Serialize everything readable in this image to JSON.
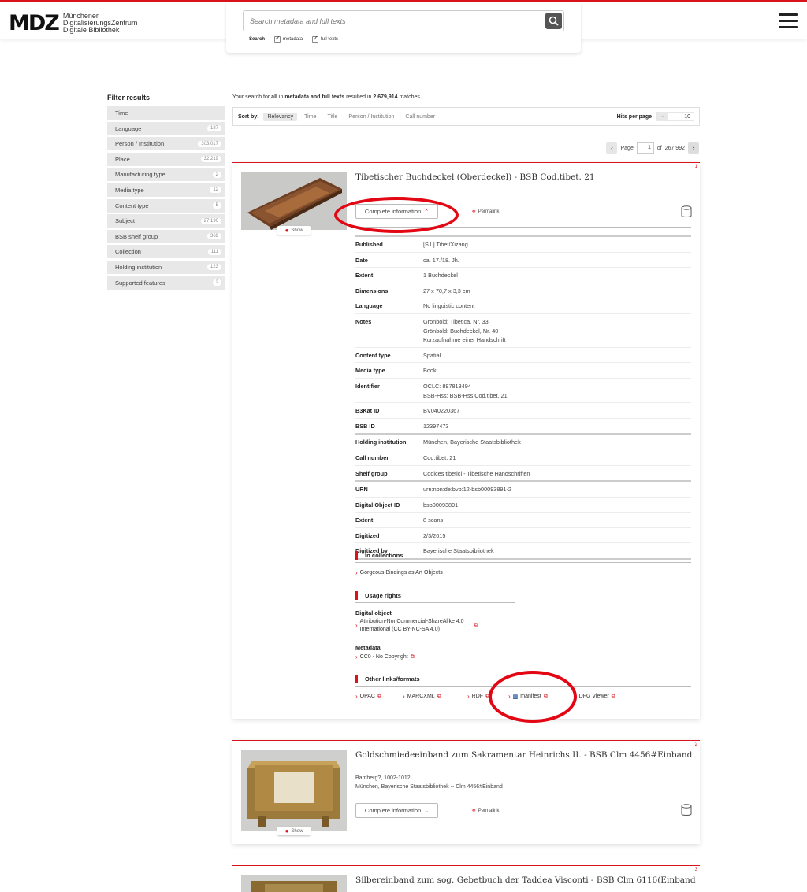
{
  "header": {
    "logo_mark": "MDZ",
    "logo_lines": [
      "Münchener",
      "DigitalisierungsZentrum",
      "Digitale Bibliothek"
    ],
    "search_placeholder": "Search metadata and full texts",
    "search_label": "Search",
    "opt_metadata": "metadata",
    "opt_fulltexts": "full texts"
  },
  "sidebar": {
    "title": "Filter results",
    "facets": [
      {
        "label": "Time",
        "count": ""
      },
      {
        "label": "Language",
        "count": "187"
      },
      {
        "label": "Person / Institution",
        "count": "303,017"
      },
      {
        "label": "Place",
        "count": "32,219"
      },
      {
        "label": "Manufacturing type",
        "count": "2"
      },
      {
        "label": "Media type",
        "count": "12"
      },
      {
        "label": "Content type",
        "count": "5"
      },
      {
        "label": "Subject",
        "count": "27,190"
      },
      {
        "label": "BSB shelf group",
        "count": "369"
      },
      {
        "label": "Collection",
        "count": "111"
      },
      {
        "label": "Holding institution",
        "count": "123"
      },
      {
        "label": "Supported features",
        "count": "2"
      }
    ]
  },
  "summary": {
    "prefix": "Your search for ",
    "all": "all",
    "mid1": " in ",
    "scope": "metadata and full texts",
    "mid2": " resulted in ",
    "count": "2,679,914",
    "suffix": " matches."
  },
  "sort": {
    "label": "Sort by:",
    "options": [
      "Relevancy",
      "Time",
      "Title",
      "Person / Institution",
      "Call number"
    ],
    "hits_label": "Hits per page",
    "hits_value": "10"
  },
  "pager": {
    "page_label": "Page",
    "page": "1",
    "of_label": "of",
    "total": "267,992"
  },
  "results": [
    {
      "num": "1",
      "title": "Tibetischer Buchdeckel (Oberdeckel) - BSB Cod.tibet. 21",
      "show": "Show",
      "complete": "Complete information",
      "permalink": "Permalink",
      "meta": [
        {
          "k": "Published",
          "v": [
            "[S.l.] Tibet/Xizang"
          ]
        },
        {
          "k": "Date",
          "v": [
            "ca. 17./18. Jh."
          ]
        },
        {
          "k": "Extent",
          "v": [
            "1 Buchdeckel"
          ]
        },
        {
          "k": "Dimensions",
          "v": [
            "27 x 70,7 x 3,3 cm"
          ]
        },
        {
          "k": "Language",
          "v": [
            "No linguistic content"
          ]
        },
        {
          "k": "Notes",
          "v": [
            "Grönbold: Tibetica, Nr. 33",
            "Grönbold: Buchdeckel, Nr. 40",
            "Kurzaufnahme einer Handschrift"
          ]
        },
        {
          "k": "Content type",
          "v": [
            "Spatial"
          ]
        },
        {
          "k": "Media type",
          "v": [
            "Book"
          ]
        },
        {
          "k": "Identifier",
          "v": [
            "OCLC: 897813494",
            "BSB-Hss: BSB-Hss Cod.tibet. 21"
          ]
        },
        {
          "k": "B3Kat ID",
          "v": [
            "BV040220367"
          ]
        },
        {
          "k": "BSB ID",
          "v": [
            "12397473"
          ]
        },
        {
          "k": "Holding institution",
          "v": [
            "München, Bayerische Staatsbibliothek"
          ]
        },
        {
          "k": "Call number",
          "v": [
            "Cod.tibet. 21"
          ]
        },
        {
          "k": "Shelf group",
          "v": [
            "Codices tibetici - Tibetische Handschriften"
          ]
        },
        {
          "k": "URN",
          "v": [
            "urn:nbn:de:bvb:12-bsb00093891-2"
          ]
        },
        {
          "k": "Digital Object ID",
          "v": [
            "bsb00093891"
          ]
        },
        {
          "k": "Extent",
          "v": [
            "8 scans"
          ]
        },
        {
          "k": "Digitized",
          "v": [
            "2/3/2015"
          ]
        },
        {
          "k": "Digitized by",
          "v": [
            "Bayerische Staatsbibliothek"
          ]
        }
      ],
      "collections_title": "In collections",
      "collection": "Gorgeous Bindings as Art Objects",
      "usage_title": "Usage rights",
      "digital_object_label": "Digital object",
      "digital_object_license_1": "Attribution-NonCommercial-ShareAlike 4.0",
      "digital_object_license_2": "International (CC BY-NC-SA 4.0)",
      "metadata_label": "Metadata",
      "metadata_license": "CC0 - No Copyright",
      "other_title": "Other links/formats",
      "links": [
        "OPAC",
        "MARCXML",
        "RDF",
        "manifest",
        "DFG Viewer"
      ]
    },
    {
      "num": "2",
      "title": "Goldschmiedeeinband zum Sakramentar Heinrichs II. - BSB Clm 4456#Einband",
      "line1": "Bamberg?, 1002-1012",
      "line2": "München, Bayerische Staatsbibliothek -- Clm 4456#Einband",
      "show": "Show",
      "complete": "Complete information",
      "permalink": "Permalink"
    },
    {
      "num": "3",
      "title": "Silbereinband zum sog. Gebetbuch der Taddea Visconti - BSB Clm 6116(Einband"
    }
  ],
  "colors": {
    "accent": "#d8131c",
    "annotation": "#e30613"
  }
}
